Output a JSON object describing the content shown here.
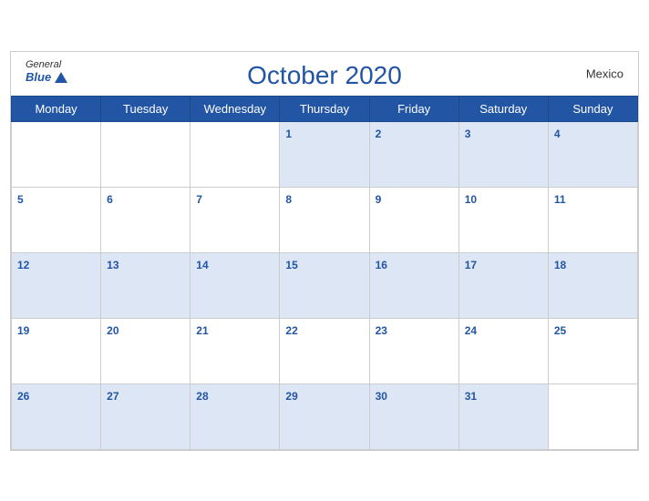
{
  "header": {
    "brand_general": "General",
    "brand_blue": "Blue",
    "title": "October 2020",
    "country": "Mexico"
  },
  "days_of_week": [
    "Monday",
    "Tuesday",
    "Wednesday",
    "Thursday",
    "Friday",
    "Saturday",
    "Sunday"
  ],
  "weeks": [
    [
      null,
      null,
      null,
      1,
      2,
      3,
      4
    ],
    [
      5,
      6,
      7,
      8,
      9,
      10,
      11
    ],
    [
      12,
      13,
      14,
      15,
      16,
      17,
      18
    ],
    [
      19,
      20,
      21,
      22,
      23,
      24,
      25
    ],
    [
      26,
      27,
      28,
      29,
      30,
      31,
      null
    ]
  ]
}
